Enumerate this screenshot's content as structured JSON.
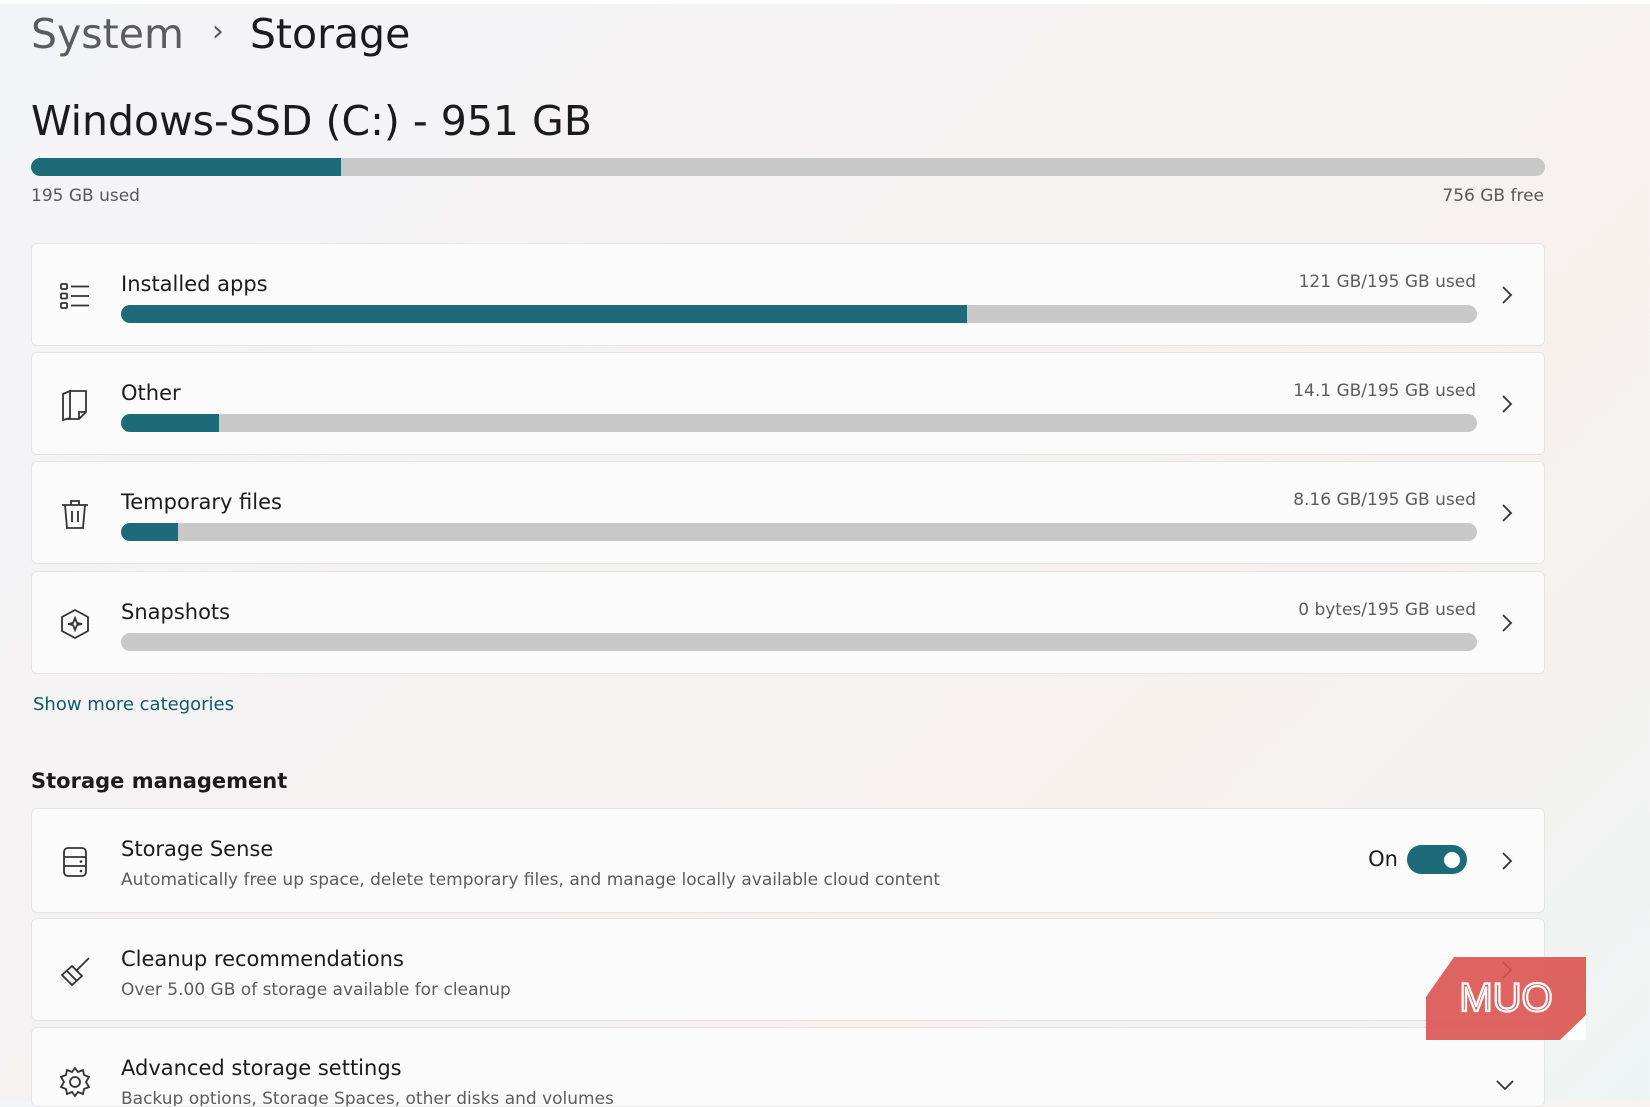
{
  "breadcrumb": {
    "parent": "System",
    "separator": "›",
    "current": "Storage"
  },
  "drive": {
    "title": "Windows-SSD (C:) - 951 GB",
    "used_label": "195 GB used",
    "free_label": "756 GB free",
    "used_fraction": 0.205
  },
  "categories": [
    {
      "label": "Installed apps",
      "usage": "121 GB/195 GB used",
      "fraction": 0.624,
      "icon": "list-icon"
    },
    {
      "label": "Other",
      "usage": "14.1 GB/195 GB used",
      "fraction": 0.072,
      "icon": "document-icon"
    },
    {
      "label": "Temporary files",
      "usage": "8.16 GB/195 GB used",
      "fraction": 0.042,
      "icon": "trash-icon"
    },
    {
      "label": "Snapshots",
      "usage": "0 bytes/195 GB used",
      "fraction": 0.0,
      "icon": "snapshot-icon"
    }
  ],
  "show_more_label": "Show more categories",
  "management": {
    "heading": "Storage management",
    "items": [
      {
        "title": "Storage Sense",
        "desc": "Automatically free up space, delete temporary files, and manage locally available cloud content",
        "status": "On",
        "toggle_on": true,
        "icon": "storage-sense-icon"
      },
      {
        "title": "Cleanup recommendations",
        "desc": "Over 5.00 GB of storage available for cleanup",
        "icon": "broom-icon"
      },
      {
        "title": "Advanced storage settings",
        "desc": "Backup options, Storage Spaces, other disks and volumes",
        "icon": "gear-icon"
      }
    ]
  },
  "watermark": "MUO",
  "colors": {
    "accent": "#1d6b79",
    "track": "#c8c8c8",
    "link": "#0e5a6a",
    "watermark": "#d9534f"
  }
}
